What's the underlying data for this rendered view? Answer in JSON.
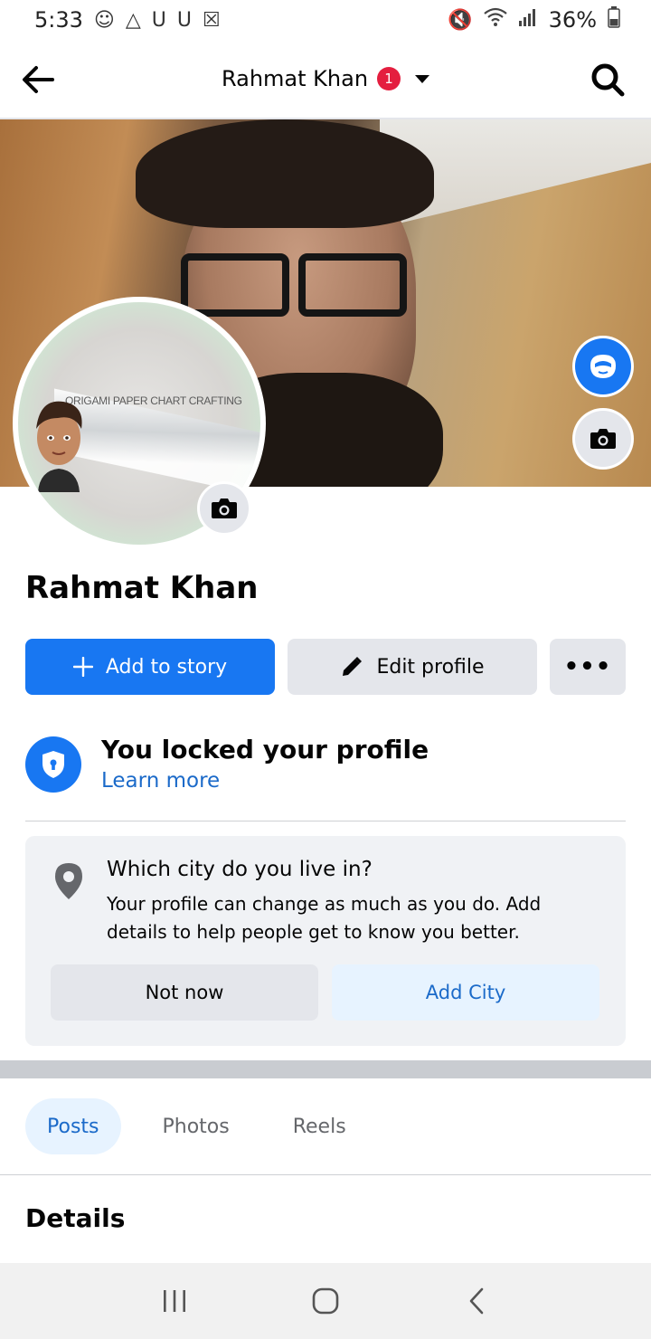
{
  "status_bar": {
    "time": "5:33",
    "left_icons": [
      "notification-icon",
      "drive-icon",
      "u-icon",
      "u-icon",
      "x-icon"
    ],
    "battery": "36%"
  },
  "header": {
    "title": "Rahmat Khan",
    "badge_count": "1"
  },
  "profile": {
    "picture_caption": "ORIGAMI PAPER CHART CRAFTING",
    "name": "Rahmat Khan"
  },
  "actions": {
    "story_label": "Add to story",
    "edit_label": "Edit profile",
    "more_label": "•••"
  },
  "locked": {
    "title": "You locked your profile",
    "link": "Learn more"
  },
  "city_prompt": {
    "question": "Which city do you live in?",
    "description": "Your profile can change as much as you do. Add details to help people get to know you better.",
    "not_now_label": "Not now",
    "add_city_label": "Add City"
  },
  "tabs": [
    {
      "label": "Posts",
      "active": true
    },
    {
      "label": "Photos",
      "active": false
    },
    {
      "label": "Reels",
      "active": false
    }
  ],
  "details": {
    "title": "Details"
  },
  "colors": {
    "accent": "#1877f2",
    "link": "#1b6ac9",
    "badge": "#e41e3f",
    "gray_button": "#e4e6eb",
    "card_bg": "#f0f2f5"
  }
}
